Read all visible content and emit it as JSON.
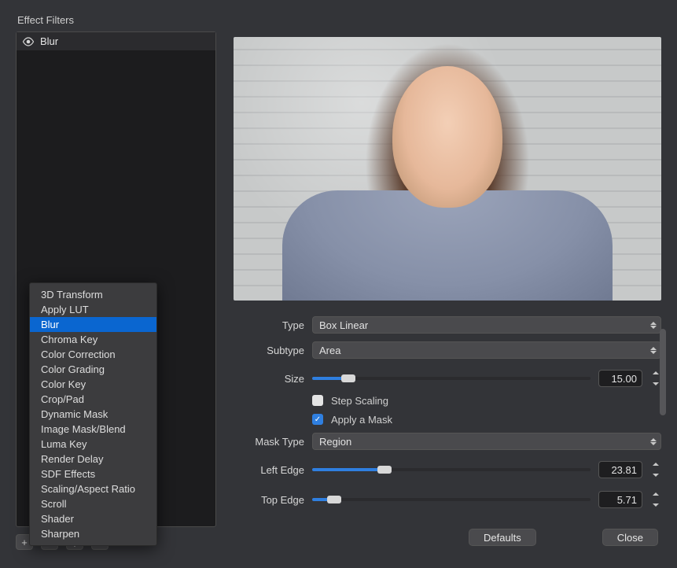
{
  "panel_title": "Effect Filters",
  "active_filters": [
    {
      "name": "Blur",
      "visible": true
    }
  ],
  "context_menu": {
    "items": [
      "3D Transform",
      "Apply LUT",
      "Blur",
      "Chroma Key",
      "Color Correction",
      "Color Grading",
      "Color Key",
      "Crop/Pad",
      "Dynamic Mask",
      "Image Mask/Blend",
      "Luma Key",
      "Render Delay",
      "SDF Effects",
      "Scaling/Aspect Ratio",
      "Scroll",
      "Shader",
      "Sharpen"
    ],
    "selected_index": 2
  },
  "labels": {
    "type": "Type",
    "subtype": "Subtype",
    "size": "Size",
    "step_scaling": "Step Scaling",
    "apply_mask": "Apply a Mask",
    "mask_type": "Mask Type",
    "left_edge": "Left Edge",
    "top_edge": "Top Edge",
    "defaults": "Defaults",
    "close": "Close"
  },
  "values": {
    "type": "Box Linear",
    "subtype": "Area",
    "size": "15.00",
    "size_pct": 13,
    "step_scaling": false,
    "apply_mask": true,
    "mask_type": "Region",
    "left_edge": "23.81",
    "left_edge_pct": 26,
    "top_edge": "5.71",
    "top_edge_pct": 8
  },
  "icons": {
    "eye": "eye-icon",
    "plus": "+",
    "minus": "−",
    "reorder": "⇕",
    "check": "✓"
  }
}
